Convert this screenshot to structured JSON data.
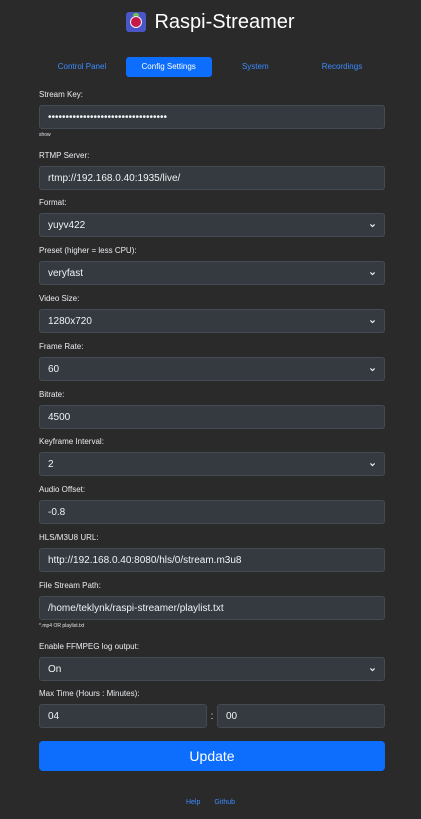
{
  "header": {
    "title": "Raspi-Streamer",
    "logo_icon": "raspberry-pi-icon"
  },
  "tabs": [
    {
      "label": "Control Panel",
      "active": false
    },
    {
      "label": "Config Settings",
      "active": true
    },
    {
      "label": "System",
      "active": false
    },
    {
      "label": "Recordings",
      "active": false
    }
  ],
  "form": {
    "stream_key": {
      "label": "Stream Key:",
      "value": "••••••••••••••••••••••••••••••••••",
      "hint": "show"
    },
    "rtmp_server": {
      "label": "RTMP Server:",
      "value": "rtmp://192.168.0.40:1935/live/"
    },
    "format": {
      "label": "Format:",
      "value": "yuyv422"
    },
    "preset": {
      "label": "Preset (higher = less CPU):",
      "value": "veryfast"
    },
    "video_size": {
      "label": "Video Size:",
      "value": "1280x720"
    },
    "frame_rate": {
      "label": "Frame Rate:",
      "value": "60"
    },
    "bitrate": {
      "label": "Bitrate:",
      "value": "4500"
    },
    "keyframe_interval": {
      "label": "Keyframe Interval:",
      "value": "2"
    },
    "audio_offset": {
      "label": "Audio Offset:",
      "value": "-0.8"
    },
    "hls_url": {
      "label": "HLS/M3U8 URL:",
      "value": "http://192.168.0.40:8080/hls/0/stream.m3u8"
    },
    "file_stream_path": {
      "label": "File Stream Path:",
      "value": "/home/teklynk/raspi-streamer/playlist.txt",
      "hint": "*.mp4 OR playlist.txt"
    },
    "ffmpeg_log": {
      "label": "Enable FFMPEG log output:",
      "value": "On"
    },
    "max_time": {
      "label": "Max Time (Hours : Minutes):",
      "hours": "04",
      "separator": ":",
      "minutes": "00"
    }
  },
  "update_label": "Update",
  "footer": {
    "help": "Help",
    "github": "Github"
  },
  "colors": {
    "background": "#2a2a2b",
    "input_bg": "#343a40",
    "accent": "#0d6efd",
    "link": "#3d8bfd"
  }
}
